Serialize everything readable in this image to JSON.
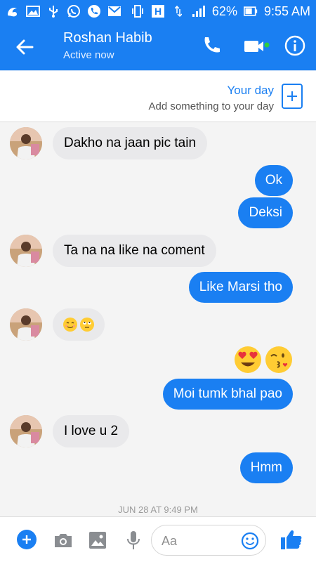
{
  "status_bar": {
    "battery_percent": "62%",
    "time": "9:55 AM"
  },
  "header": {
    "contact_name": "Roshan Habib",
    "contact_status": "Active now"
  },
  "your_day": {
    "title": "Your day",
    "subtitle": "Add something to your day"
  },
  "messages": [
    {
      "from": "them",
      "text": "Dakho na jaan pic tain"
    },
    {
      "from": "me",
      "text": "Ok"
    },
    {
      "from": "me",
      "text": "Deksi"
    },
    {
      "from": "them",
      "text": "Ta na na like na coment"
    },
    {
      "from": "me",
      "text": "Like Marsi tho"
    },
    {
      "from": "them",
      "emojis": [
        "blush-emoji",
        "eye-roll-emoji"
      ]
    },
    {
      "from": "me",
      "emojis": [
        "heart-eyes-emoji",
        "kissing-wink-emoji"
      ]
    },
    {
      "from": "me",
      "text": "Moi tumk bhal pao"
    },
    {
      "from": "them",
      "text": "I love u 2"
    },
    {
      "from": "me",
      "text": "Hmm"
    }
  ],
  "timestamp": "JUN 28 AT 9:49 PM",
  "composer": {
    "placeholder": "Aa"
  },
  "colors": {
    "accent": "#1a7ff2",
    "incoming_bubble": "#e9e9eb",
    "active_dot": "#2ecc40"
  }
}
